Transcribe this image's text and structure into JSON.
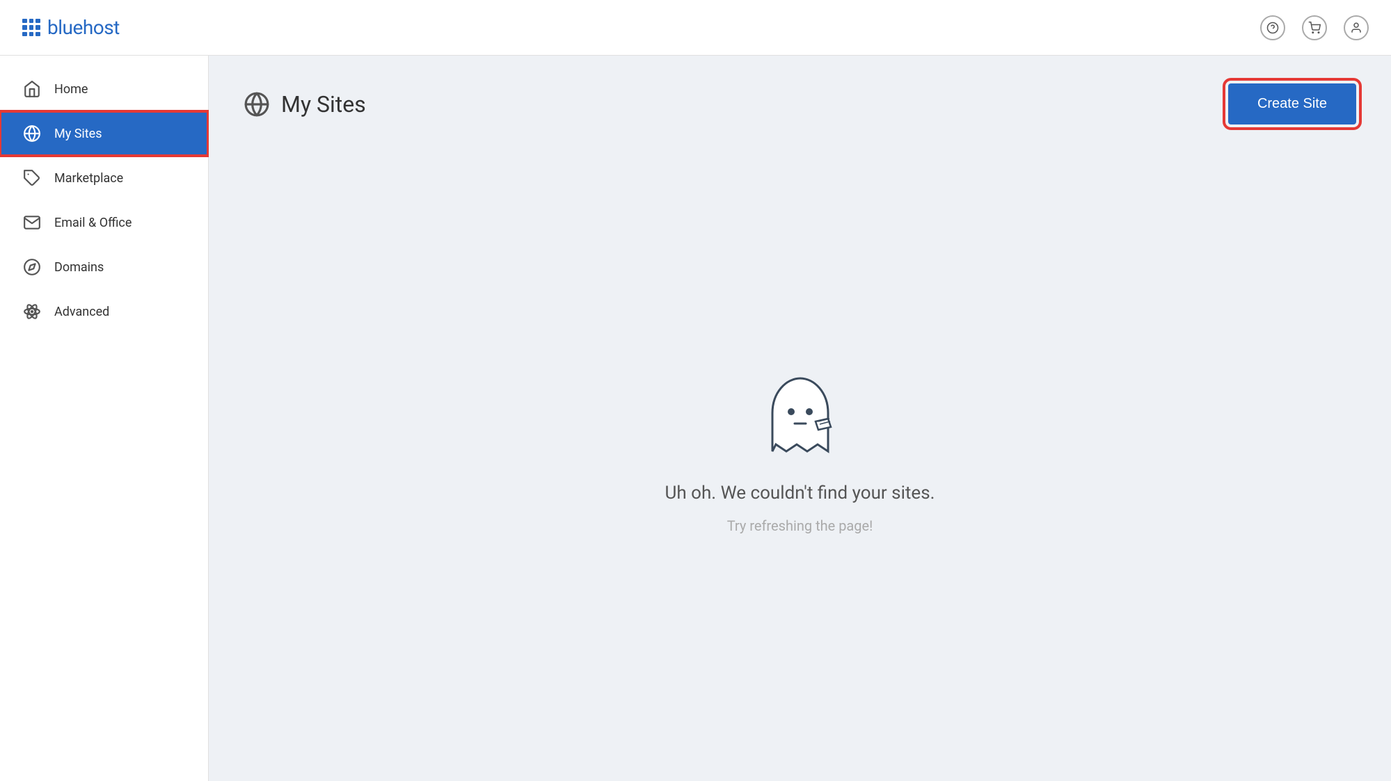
{
  "header": {
    "logo_text": "bluehost",
    "actions": {
      "help": "?",
      "cart": "cart-icon",
      "account": "account-icon"
    }
  },
  "sidebar": {
    "items": [
      {
        "id": "home",
        "label": "Home",
        "icon": "home-icon",
        "active": false
      },
      {
        "id": "my-sites",
        "label": "My Sites",
        "icon": "wordpress-icon",
        "active": true
      },
      {
        "id": "marketplace",
        "label": "Marketplace",
        "icon": "tag-icon",
        "active": false
      },
      {
        "id": "email-office",
        "label": "Email & Office",
        "icon": "email-icon",
        "active": false
      },
      {
        "id": "domains",
        "label": "Domains",
        "icon": "compass-icon",
        "active": false
      },
      {
        "id": "advanced",
        "label": "Advanced",
        "icon": "atom-icon",
        "active": false
      }
    ]
  },
  "main": {
    "page_title": "My Sites",
    "create_site_label": "Create Site",
    "empty_state": {
      "title": "Uh oh. We couldn't find your sites.",
      "subtitle": "Try refreshing the page!"
    }
  }
}
